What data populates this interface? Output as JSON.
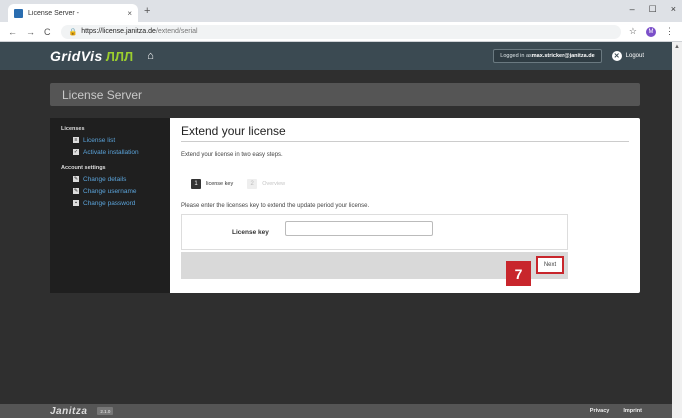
{
  "browser": {
    "tab_title": "License Server -",
    "tab_close": "×",
    "new_tab": "+",
    "win_min": "–",
    "win_max": "☐",
    "win_close": "×",
    "back": "←",
    "forward": "→",
    "reload": "C",
    "url_host": "https://license.janitza.de",
    "url_path": "/extend/serial",
    "star": "☆",
    "profile": "M",
    "menu": "⋮"
  },
  "header": {
    "logo": "GridVis",
    "logo_wave": "ЛЛЛ",
    "home_icon": "⌂",
    "logged_in_prefix": "Logged in as ",
    "logged_in_user": "max.stricker@janitza.de",
    "logout_label": "Logout"
  },
  "banner": {
    "title": "License Server"
  },
  "sidebar": {
    "sections": [
      {
        "title": "Licenses",
        "items": [
          {
            "label": "License list",
            "icon": "list-icon"
          },
          {
            "label": "Activate installation",
            "icon": "checkbox-icon"
          }
        ]
      },
      {
        "title": "Account settings",
        "items": [
          {
            "label": "Change details",
            "icon": "user-edit-icon"
          },
          {
            "label": "Change username",
            "icon": "user-edit-icon"
          },
          {
            "label": "Change password",
            "icon": "lock-icon"
          }
        ]
      }
    ]
  },
  "content": {
    "title": "Extend your license",
    "intro": "Extend your license in two easy steps.",
    "steps": [
      {
        "num": "1",
        "label": "license key",
        "active": true
      },
      {
        "num": "2",
        "label": "Overview",
        "active": false
      }
    ],
    "instruction": "Please enter the licenses key to extend the update period your license.",
    "license_key_label": "License key",
    "license_key_value": "",
    "next_label": "Next",
    "annotation_number": "7"
  },
  "footer": {
    "logo": "Janitza",
    "version": "2.1.0",
    "links": [
      "Privacy",
      "Imprint"
    ]
  },
  "colors": {
    "accent_red": "#c8262c",
    "header_bg": "#3b4a52",
    "link_blue": "#5aa2d8",
    "logo_green": "#9ccf2e"
  }
}
